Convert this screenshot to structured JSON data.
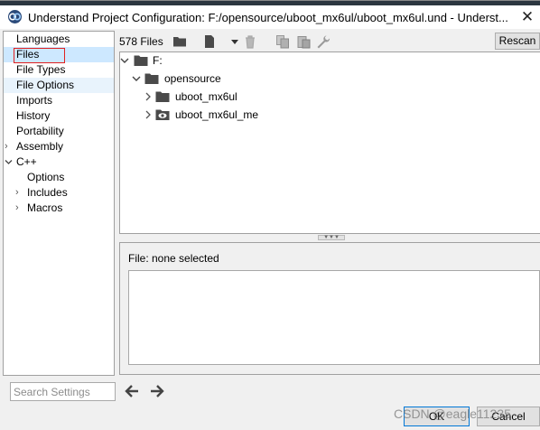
{
  "window": {
    "title": "Understand Project Configuration: F:/opensource/uboot_mx6ul/uboot_mx6ul.und - Underst...",
    "close_icon": "close-icon"
  },
  "sidebar": {
    "items": [
      {
        "label": "Languages"
      },
      {
        "label": "Files"
      },
      {
        "label": "File Types"
      },
      {
        "label": "File Options"
      },
      {
        "label": "Imports"
      },
      {
        "label": "History"
      },
      {
        "label": "Portability"
      },
      {
        "label": "Assembly"
      },
      {
        "label": "C++"
      },
      {
        "label": "Options"
      },
      {
        "label": "Includes"
      },
      {
        "label": "Macros"
      }
    ],
    "selected": "Files"
  },
  "toolbar": {
    "files_count": "578 Files",
    "rescan_label": "Rescan",
    "icons": [
      "folder-icon",
      "file-icon",
      "dropdown-arrow-icon",
      "trash-icon",
      "copy-icon",
      "paste-icon",
      "wrench-icon"
    ]
  },
  "tree": {
    "nodes": [
      {
        "label": "F:",
        "expanded": true
      },
      {
        "label": "opensource",
        "expanded": true
      },
      {
        "label": "uboot_mx6ul",
        "expanded": false
      },
      {
        "label": "uboot_mx6ul_me",
        "expanded": false
      }
    ]
  },
  "detail": {
    "status": "File: none selected"
  },
  "footer": {
    "search_placeholder": "Search Settings",
    "ok_label": "OK",
    "cancel_label": "Cancel",
    "watermark": "CSDN @eagle11235"
  },
  "colors": {
    "selection": "#cde8ff",
    "highlight_box": "#e02020",
    "accent": "#0078d7"
  }
}
